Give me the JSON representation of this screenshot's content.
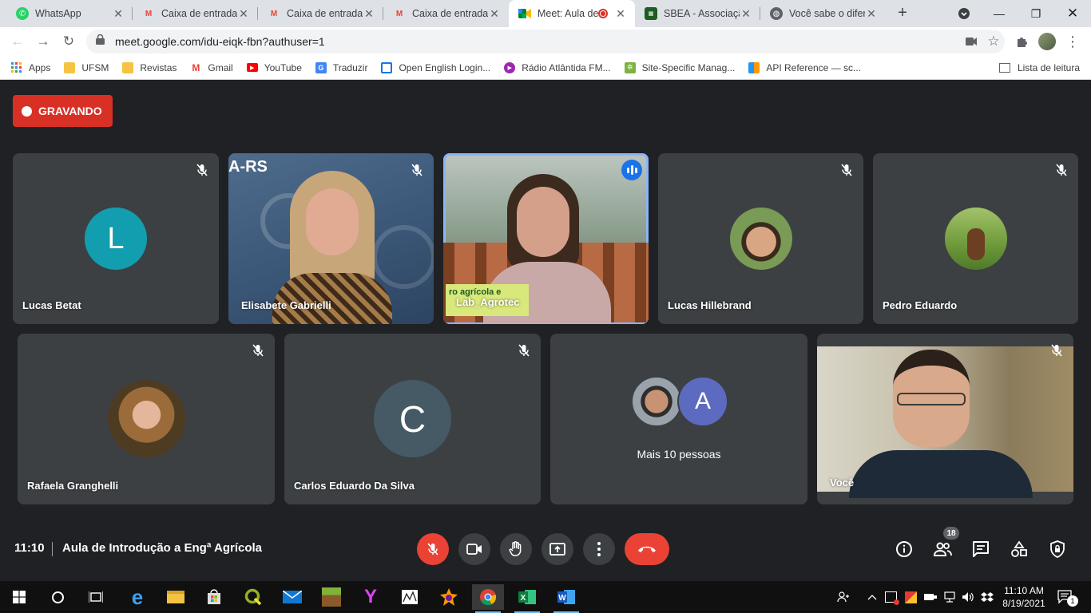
{
  "browser": {
    "tabs": [
      {
        "title": "WhatsApp",
        "favicon": "whatsapp-icon"
      },
      {
        "title": "Caixa de entrada",
        "favicon": "gmail-icon"
      },
      {
        "title": "Caixa de entrada",
        "favicon": "gmail-icon"
      },
      {
        "title": "Caixa de entrada",
        "favicon": "gmail-icon"
      },
      {
        "title": "Meet: Aula de",
        "favicon": "meet-icon",
        "active": true,
        "recording": true
      },
      {
        "title": "SBEA - Associação",
        "favicon": "sbea-icon"
      },
      {
        "title": "Você sabe o diferencial",
        "favicon": "globe-icon"
      }
    ],
    "url": "meet.google.com/idu-eiqk-fbn?authuser=1",
    "bookmarks": [
      {
        "label": "Apps",
        "icon": "apps-grid-icon",
        "color": "#4285f4"
      },
      {
        "label": "UFSM",
        "icon": "folder-icon",
        "color": "#f6c343"
      },
      {
        "label": "Revistas",
        "icon": "folder-icon",
        "color": "#f6c343"
      },
      {
        "label": "Gmail",
        "icon": "gmail-icon",
        "color": "#ea4335"
      },
      {
        "label": "YouTube",
        "icon": "youtube-icon",
        "color": "#ff0000"
      },
      {
        "label": "Traduzir",
        "icon": "translate-icon",
        "color": "#4285f4"
      },
      {
        "label": "Open English Login...",
        "icon": "open-english-icon",
        "color": "#1a73e8"
      },
      {
        "label": "Rádio Atlântida FM...",
        "icon": "radio-icon",
        "color": "#9c27b0"
      },
      {
        "label": "Site-Specific Manag...",
        "icon": "plant-icon",
        "color": "#7cb342"
      },
      {
        "label": "API Reference — sc...",
        "icon": "api-icon",
        "color": "#ff9800"
      }
    ],
    "reading_list": "Lista de leitura"
  },
  "meet": {
    "recording_label": "GRAVANDO",
    "participants": [
      {
        "name": "Lucas Betat",
        "initial": "L",
        "avatar_color": "#129eaf",
        "type": "initial"
      },
      {
        "name": "Elisabete Gabrielli",
        "type": "video"
      },
      {
        "name": "Lab_Agrotec",
        "type": "video",
        "speaking": true
      },
      {
        "name": "Lucas Hillebrand",
        "type": "photo"
      },
      {
        "name": "Pedro Eduardo",
        "type": "photo"
      },
      {
        "name": "Rafaela Granghelli",
        "type": "photo"
      },
      {
        "name": "Carlos Eduardo Da Silva",
        "initial": "C",
        "avatar_color": "#455a64",
        "type": "initial"
      },
      {
        "name": "Mais 10 pessoas",
        "type": "overflow",
        "initial": "A",
        "avatar_color": "#5c6bc0"
      },
      {
        "name": "Você",
        "type": "video"
      }
    ],
    "video_overlay_text": {
      "banner": "ro agrícola e",
      "logo": "A-RS"
    },
    "time": "11:10",
    "title": "Aula de Introdução a Engª Agrícola",
    "participant_count": "18"
  },
  "taskbar": {
    "apps": [
      "windows-start-icon",
      "search-icon",
      "task-view-icon",
      "edge-icon",
      "file-explorer-icon",
      "store-icon",
      "qgis-icon",
      "mail-icon",
      "minecraft-icon",
      "yandex-icon",
      "app-icon",
      "game-icon",
      "chrome-icon",
      "excel-icon",
      "word-icon"
    ],
    "time": "11:10 AM",
    "date": "8/19/2021",
    "notifications": "1"
  }
}
